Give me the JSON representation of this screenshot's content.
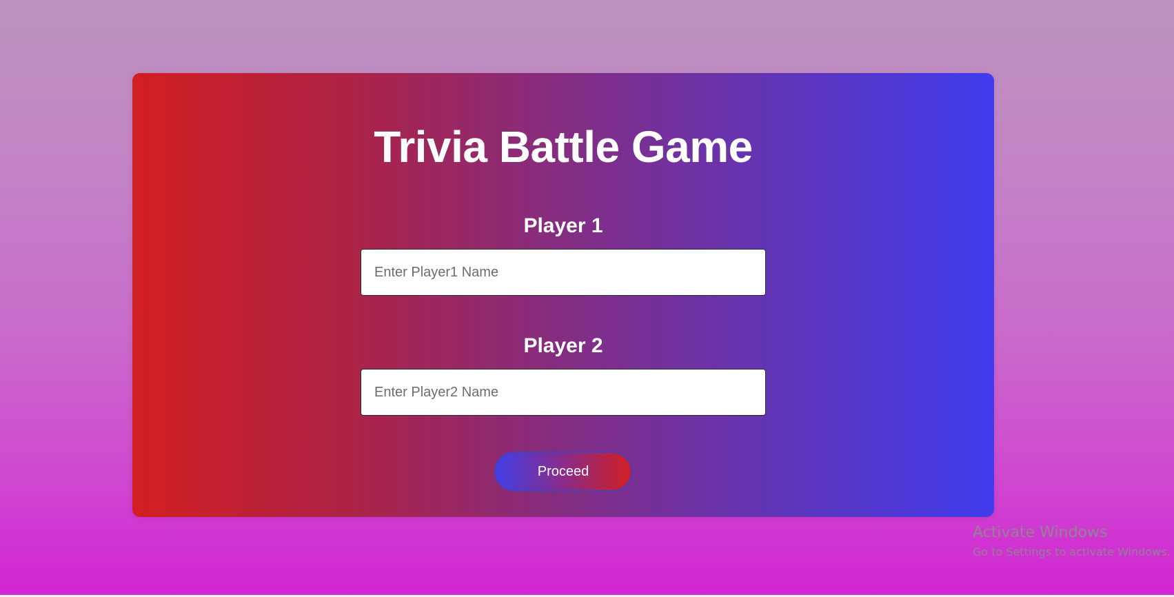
{
  "app": {
    "title": "Trivia Battle Game"
  },
  "players": [
    {
      "label": "Player 1",
      "placeholder": "Enter Player1 Name",
      "value": ""
    },
    {
      "label": "Player 2",
      "placeholder": "Enter Player2 Name",
      "value": ""
    }
  ],
  "actions": {
    "proceed_label": "Proceed"
  },
  "watermark": {
    "title": "Activate Windows",
    "subtitle": "Go to Settings to activate Windows."
  },
  "colors": {
    "card_gradient_start": "#d21f22",
    "card_gradient_end": "#403ced",
    "page_gradient_top": "#bc93bf",
    "page_gradient_bottom": "#d224d4"
  }
}
